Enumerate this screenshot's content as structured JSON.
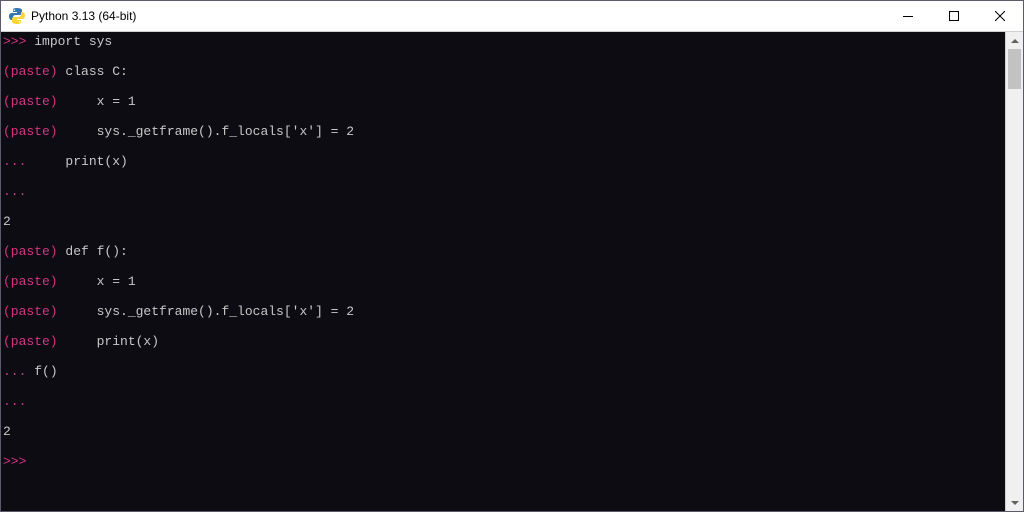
{
  "window": {
    "title": "Python 3.13 (64-bit)"
  },
  "terminal": {
    "lines": [
      {
        "prompt": ">>> ",
        "promptClass": "magenta",
        "text": "import sys"
      },
      {
        "prompt": "(paste) ",
        "promptClass": "magenta",
        "text": "class C:"
      },
      {
        "prompt": "(paste) ",
        "promptClass": "magenta",
        "text": "    x = 1"
      },
      {
        "prompt": "(paste) ",
        "promptClass": "magenta",
        "text": "    sys._getframe().f_locals['x'] = 2"
      },
      {
        "prompt": "... ",
        "promptClass": "magenta",
        "text": "    print(x)"
      },
      {
        "prompt": "... ",
        "promptClass": "magenta",
        "text": ""
      },
      {
        "prompt": "",
        "promptClass": "",
        "text": "2"
      },
      {
        "prompt": "(paste) ",
        "promptClass": "magenta",
        "text": "def f():"
      },
      {
        "prompt": "(paste) ",
        "promptClass": "magenta",
        "text": "    x = 1"
      },
      {
        "prompt": "(paste) ",
        "promptClass": "magenta",
        "text": "    sys._getframe().f_locals['x'] = 2"
      },
      {
        "prompt": "(paste) ",
        "promptClass": "magenta",
        "text": "    print(x)"
      },
      {
        "prompt": "... ",
        "promptClass": "magenta",
        "text": "f()"
      },
      {
        "prompt": "... ",
        "promptClass": "magenta",
        "text": ""
      },
      {
        "prompt": "",
        "promptClass": "",
        "text": "2"
      },
      {
        "prompt": ">>> ",
        "promptClass": "magenta",
        "text": ""
      }
    ]
  }
}
